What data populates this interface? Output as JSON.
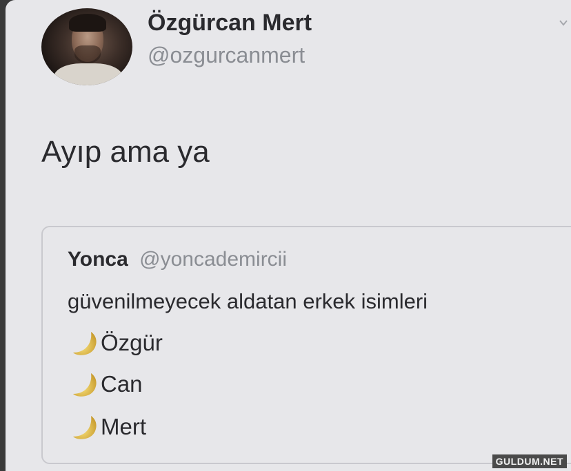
{
  "tweet": {
    "author": {
      "display_name": "Özgürcan Mert",
      "handle": "@ozgurcanmert"
    },
    "text": "Ayıp ama ya",
    "menu_icon": "chevron-down-icon"
  },
  "quoted_tweet": {
    "author": {
      "display_name": "Yonca",
      "handle": "@yoncademircii"
    },
    "text": "güvenilmeyecek aldatan erkek isimleri",
    "list_icon": "crescent-moon-emoji",
    "names": [
      "Özgür",
      "Can",
      "Mert"
    ]
  },
  "watermark": "GULDUM.NET"
}
